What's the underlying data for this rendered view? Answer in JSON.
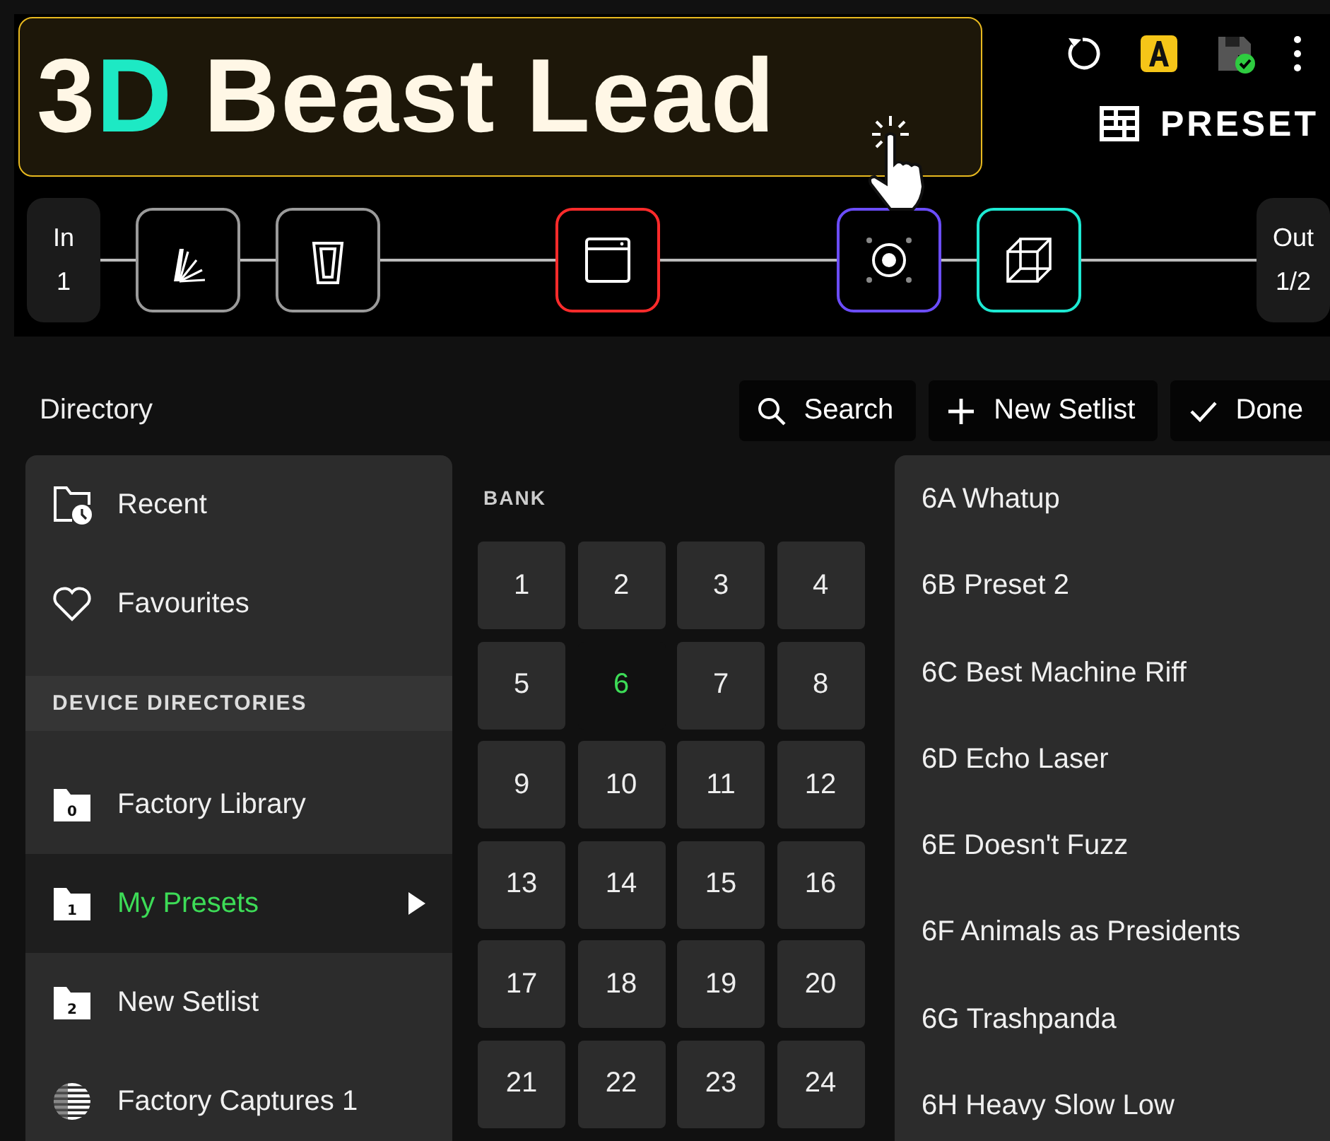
{
  "preset": {
    "title": "3**D** Beast Lead",
    "mode": "PRESET"
  },
  "chain": [
    {
      "kind": "io",
      "label": "In",
      "value": "1"
    },
    {
      "kind": "fan",
      "color": "#9a9a9a"
    },
    {
      "kind": "glass",
      "color": "#9a9a9a"
    },
    {
      "kind": "empty"
    },
    {
      "kind": "window",
      "color": "#ff2b2b"
    },
    {
      "kind": "empty"
    },
    {
      "kind": "speaker",
      "color": "#6b4dff"
    },
    {
      "kind": "cube",
      "color": "#1de9d2"
    },
    {
      "kind": "empty"
    },
    {
      "kind": "io",
      "label": "Out",
      "value": "1/2"
    }
  ],
  "directory": {
    "title": "Directory",
    "buttons": [
      {
        "kind": "search",
        "label": "Search"
      },
      {
        "kind": "add",
        "label": "New Setlist"
      },
      {
        "kind": "done",
        "label": "Done"
      }
    ]
  },
  "sidebar": {
    "items": [
      {
        "kind": "recent",
        "label": "Recent",
        "selected": false
      },
      {
        "kind": "favourites",
        "label": "Favourites",
        "selected": false
      },
      {
        "kind": "header",
        "label": "DEVICE DIRECTORIES"
      },
      {
        "kind": "folder",
        "badge": "0",
        "label": "Factory Library",
        "selected": false
      },
      {
        "kind": "folder",
        "badge": "1",
        "label": "My Presets",
        "selected": true
      },
      {
        "kind": "folder",
        "badge": "2",
        "label": "New Setlist",
        "selected": false
      },
      {
        "kind": "captures",
        "label": "Factory Captures 1",
        "selected": false
      }
    ]
  },
  "bank": {
    "title": "BANK",
    "cells": [
      {
        "label": "1",
        "selected": false
      },
      {
        "label": "2",
        "selected": false
      },
      {
        "label": "3",
        "selected": false
      },
      {
        "label": "4",
        "selected": false
      },
      {
        "label": "5",
        "selected": false
      },
      {
        "label": "6",
        "selected": true
      },
      {
        "label": "7",
        "selected": false
      },
      {
        "label": "8",
        "selected": false
      },
      {
        "label": "9",
        "selected": false
      },
      {
        "label": "10",
        "selected": false
      },
      {
        "label": "11",
        "selected": false
      },
      {
        "label": "12",
        "selected": false
      },
      {
        "label": "13",
        "selected": false
      },
      {
        "label": "14",
        "selected": false
      },
      {
        "label": "15",
        "selected": false
      },
      {
        "label": "16",
        "selected": false
      },
      {
        "label": "17",
        "selected": false
      },
      {
        "label": "18",
        "selected": false
      },
      {
        "label": "19",
        "selected": false
      },
      {
        "label": "20",
        "selected": false
      },
      {
        "label": "21",
        "selected": false
      },
      {
        "label": "22",
        "selected": false
      },
      {
        "label": "23",
        "selected": false
      },
      {
        "label": "24",
        "selected": false
      }
    ]
  },
  "presets": [
    {
      "label": "6A Whatup"
    },
    {
      "label": "6B Preset 2"
    },
    {
      "label": "6C Best Machine Riff"
    },
    {
      "label": "6D Echo Laser"
    },
    {
      "label": "6E Doesn't Fuzz"
    },
    {
      "label": "6F Animals as Presidents"
    },
    {
      "label": "6G Trashpanda"
    },
    {
      "label": "6H Heavy Slow Low"
    }
  ]
}
